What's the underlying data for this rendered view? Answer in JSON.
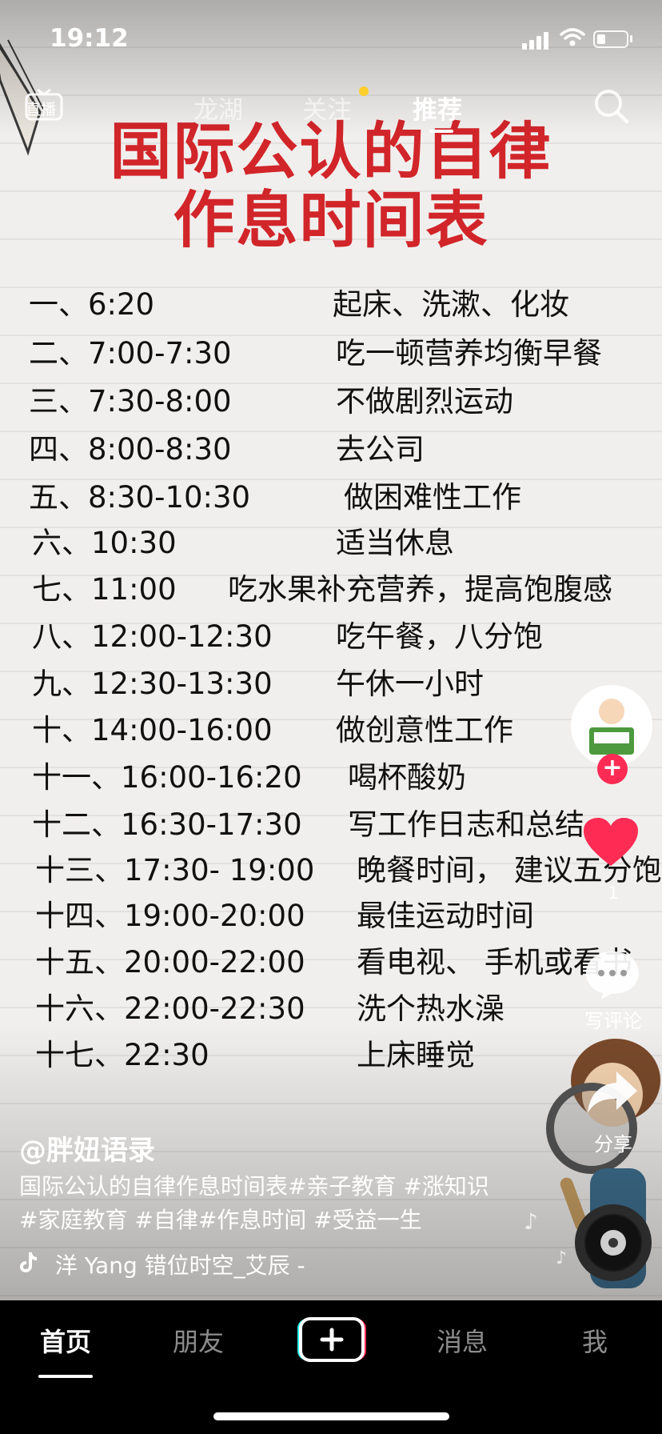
{
  "status_bar": {
    "time": "19:12"
  },
  "top_nav": {
    "live_label": "直播",
    "tabs": [
      {
        "label": "龙湖",
        "active": false
      },
      {
        "label": "关注",
        "active": false,
        "has_dot": true
      },
      {
        "label": "推荐",
        "active": true
      }
    ]
  },
  "poster": {
    "title_line1": "国际公认的自律",
    "title_line2": "作息时间表",
    "schedule": [
      {
        "num": "一、6:20",
        "activity": "起床、洗漱、化妆"
      },
      {
        "num": "二、7:00-7:30",
        "activity": "吃一顿营养均衡早餐"
      },
      {
        "num": "三、7:30-8:00",
        "activity": "不做剧烈运动"
      },
      {
        "num": "四、8:00-8:30",
        "activity": "去公司"
      },
      {
        "num": "五、8:30-10:30",
        "activity": "做困难性工作"
      },
      {
        "num": "六、10:30",
        "activity": "适当休息"
      },
      {
        "num": "七、11:00",
        "activity": "吃水果补充营养，提高饱腹感"
      },
      {
        "num": "八、12:00-12:30",
        "activity": "吃午餐，八分饱"
      },
      {
        "num": "九、12:30-13:30",
        "activity": "午休一小时"
      },
      {
        "num": "十、14:00-16:00",
        "activity": "做创意性工作"
      },
      {
        "num": "十一、16:00-16:20",
        "activity": "喝杯酸奶"
      },
      {
        "num": "十二、16:30-17:30",
        "activity": "写工作日志和总结"
      },
      {
        "num": "十三、17:30- 19:00",
        "activity": "晚餐时间， 建议五分饱"
      },
      {
        "num": "十四、19:00-20:00",
        "activity": "最佳运动时间"
      },
      {
        "num": "十五、20:00-22:00",
        "activity": "看电视、 手机或看书"
      },
      {
        "num": "十六、22:00-22:30",
        "activity": "洗个热水澡"
      },
      {
        "num": "十七、22:30",
        "activity": "上床睡觉"
      }
    ]
  },
  "right_rail": {
    "like_count": "1",
    "comment_label": "写评论",
    "share_label": "分享",
    "colors": {
      "like": "#fe2c55",
      "follow": "#fe2c55"
    }
  },
  "video_info": {
    "author": "@胖妞语录",
    "caption": "国际公认的自律作息时间表#亲子教育 #涨知识 #家庭教育 #自律#作息时间 #受益一生",
    "music": "洋 Yang    错位时空_艾辰 -"
  },
  "tab_bar": {
    "tabs": [
      {
        "label": "首页",
        "active": true
      },
      {
        "label": "朋友",
        "active": false
      },
      {
        "label": "消息",
        "active": false
      },
      {
        "label": "我",
        "active": false
      }
    ]
  }
}
